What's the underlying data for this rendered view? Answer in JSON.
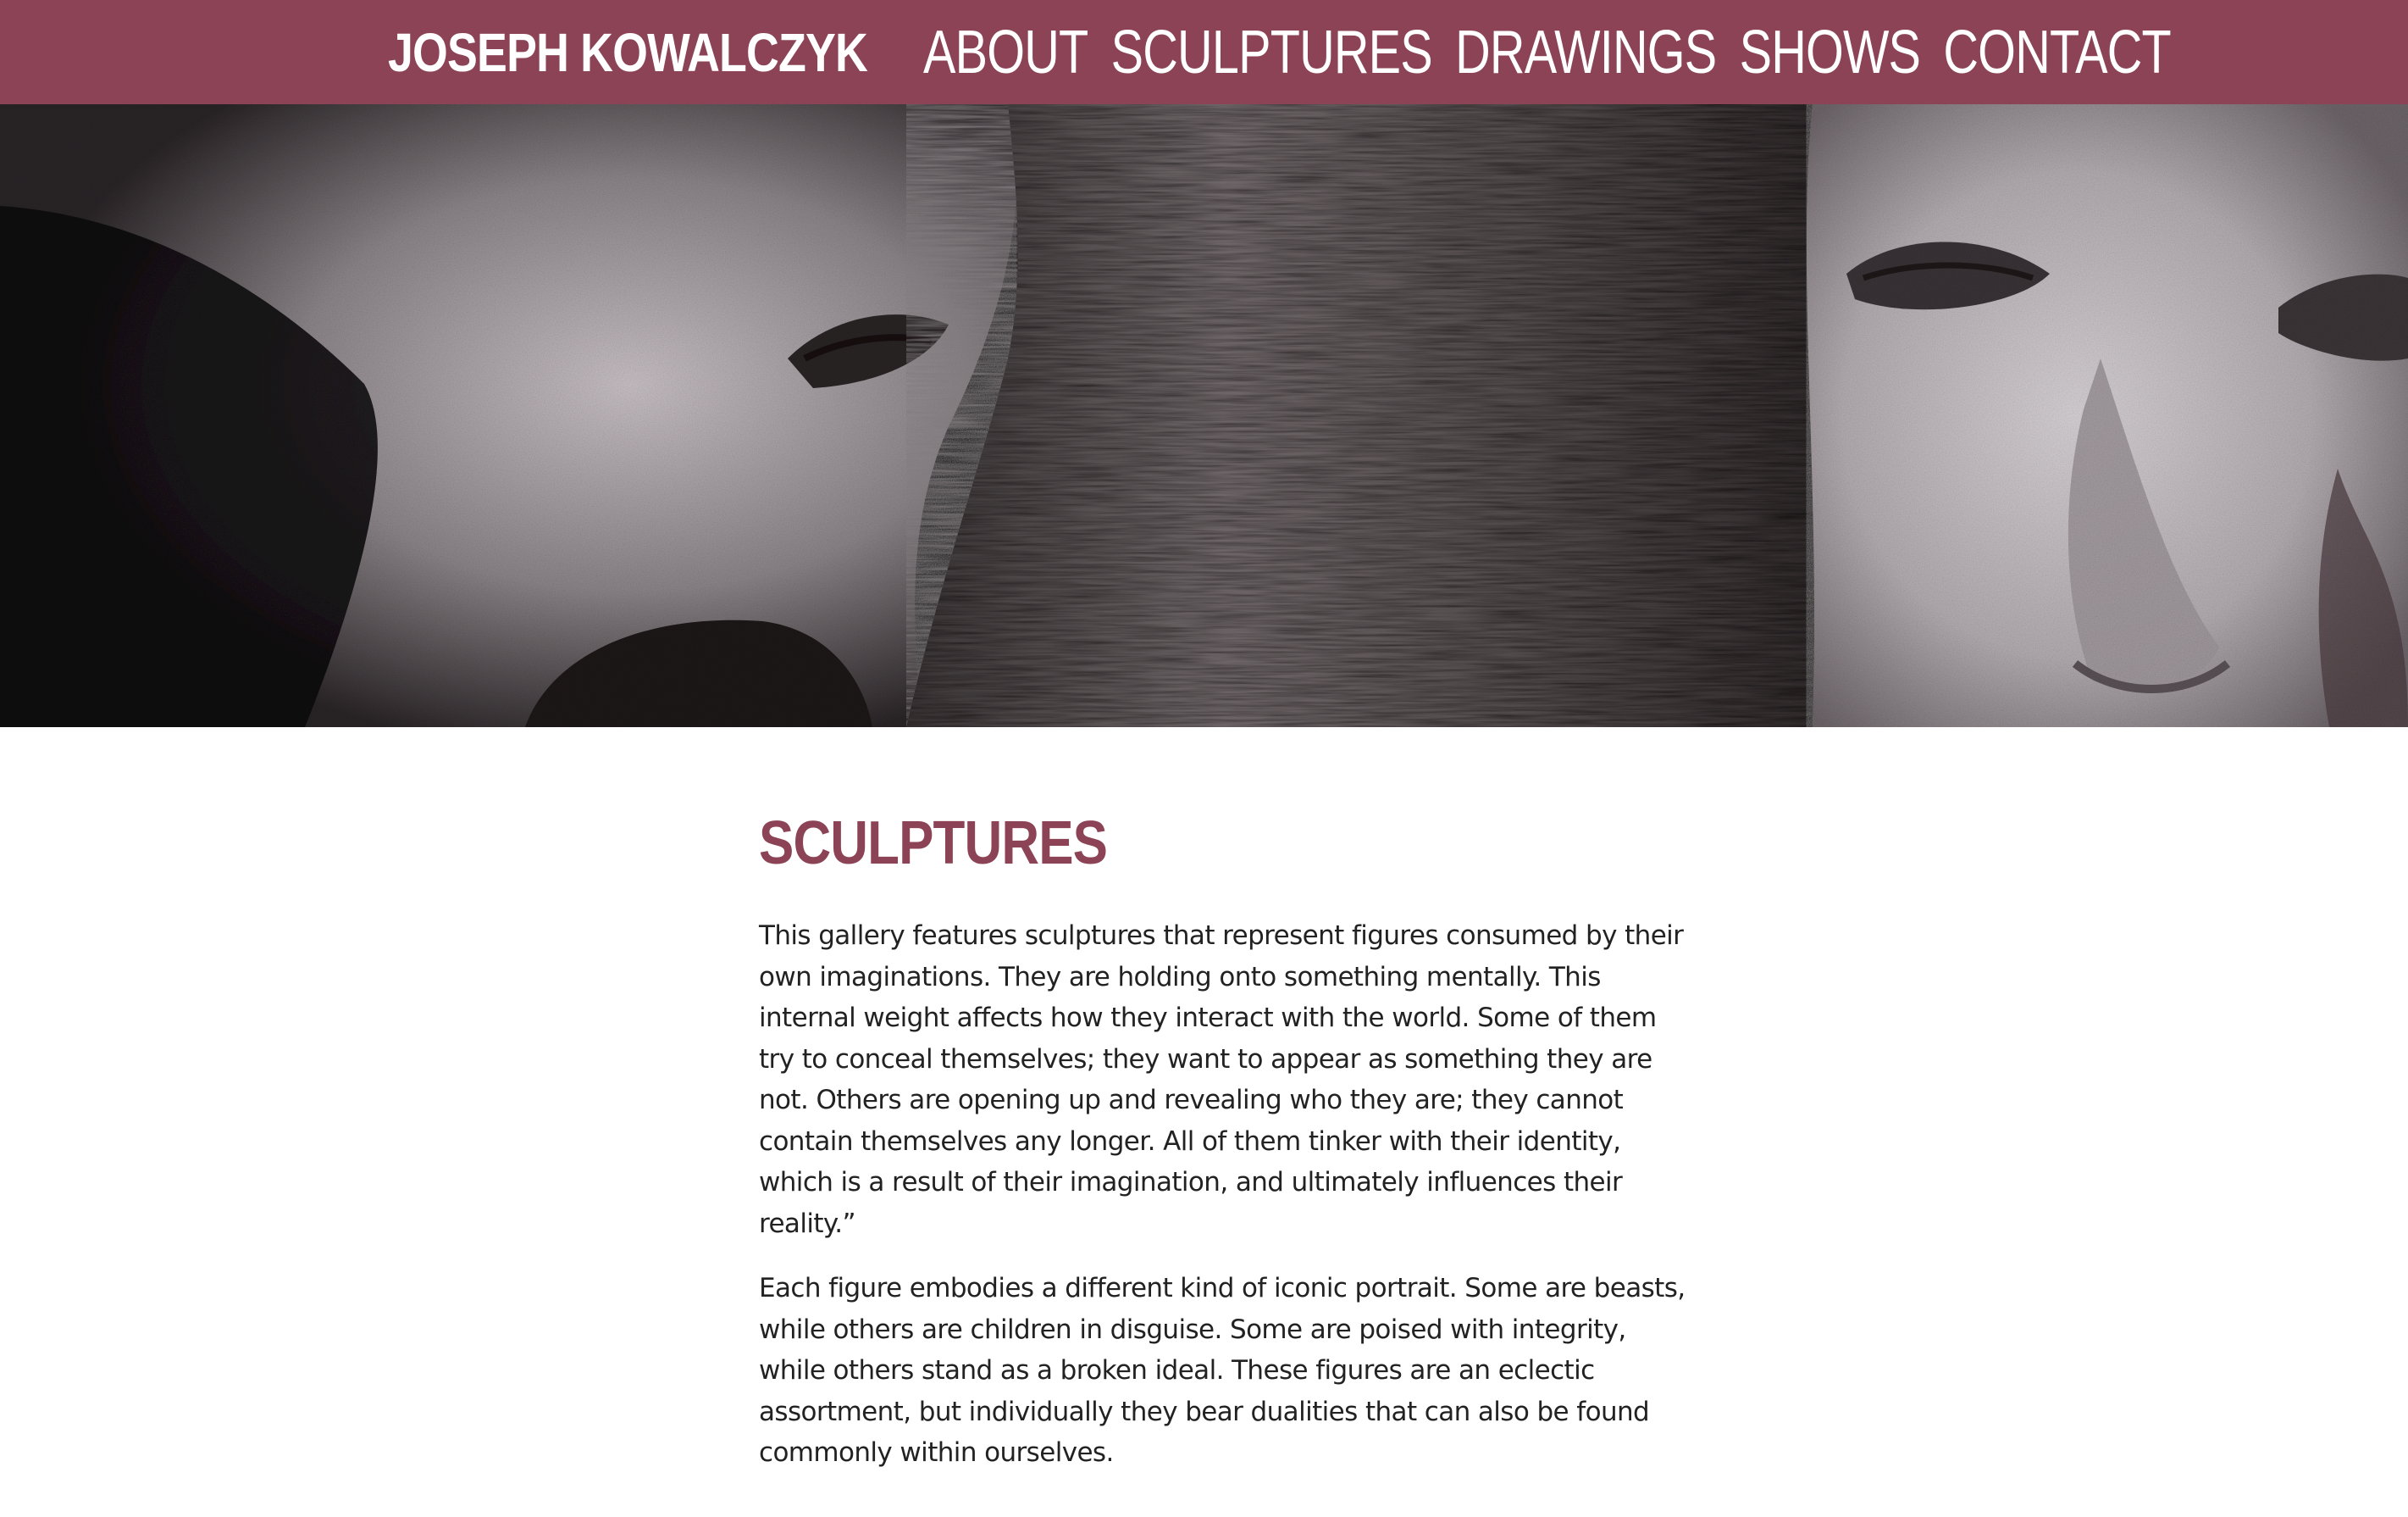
{
  "header": {
    "brand": "JOSEPH KOWALCZYK",
    "nav": [
      {
        "label": "ABOUT"
      },
      {
        "label": "SCULPTURES"
      },
      {
        "label": "DRAWINGS"
      },
      {
        "label": "SHOWS"
      },
      {
        "label": "CONTACT"
      }
    ]
  },
  "main": {
    "title": "SCULPTURES",
    "paragraphs": [
      "This gallery features sculptures that represent figures consumed by their own imaginations. They are holding onto something mentally. This internal weight affects how they interact with the world. Some of them try to conceal themselves; they want to appear as something they are not. Others are opening up and revealing who they are; they cannot contain themselves any longer. All of them tinker with their identity, which is a result of their imagination, and ultimately influences their reality.”",
      "Each figure embodies a different kind of iconic portrait. Some are beasts, while others are children in disguise. Some are poised with integrity, while others stand as a broken ideal. These figures are an eclectic assortment, but individually they bear dualities that can also be found commonly within ourselves."
    ]
  },
  "colors": {
    "accent": "#8b4355",
    "text": "#222222",
    "background": "#ffffff"
  }
}
